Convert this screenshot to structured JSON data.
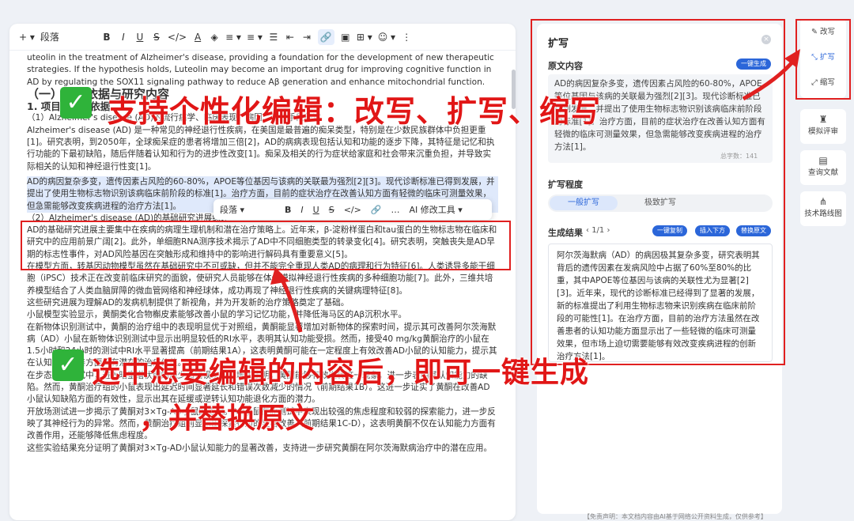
{
  "toolbar": {
    "add": "+ ▾",
    "paragraph": "段落",
    "bold": "B",
    "italic": "I",
    "underline": "U",
    "strike": "S",
    "code": "</>",
    "fontcolor": "A",
    "highlight": "◈",
    "align": "≡ ▾",
    "linespace": "≡ ▾",
    "list": "☰",
    "outdent": "⇤",
    "indent": "⇥",
    "link": "🔗",
    "image": "▣",
    "table": "⊞ ▾",
    "emoji": "☺ ▾",
    "more": "⋮"
  },
  "doc": {
    "intro": "uteolin in the treatment of Alzheimer's disease, providing a foundation for the development of new therapeutic strategies. If the hypothesis holds, Luteolin may become an important drug for improving cognitive function in AD by regulating the SOX11 signaling pathway to reduce Aβ generation and enhance mitochondrial function.",
    "h2": "（一）立项依据与研究内容",
    "h3": "1. 项目的立项依据",
    "sub1": "（1）Alzheimer's disease (AD)的流行病学、临床表现、病因、诊疗手段综述",
    "p1": "Alzheimer's disease (AD) 是一种常见的神经退行性疾病，在美国是最普遍的痴呆类型，特别是在少数民族群体中负担更重[1]。研究表明，到2050年，全球痴呆症的患者将增加三倍[2]，AD的病病表现包括认知和功能的逐步下降，其特征是记忆和执行功能的下最初缺陷，随后伴随着认知和行为的进步性改变[1]。痴呆及相关的行为症状给家庭和社会带来沉重负担，并导致实际相关的认知和神经退行性变[1]。",
    "sel": "AD的病因复杂多变，遗传因素占风险的60-80%，APOE等位基因与该病的关联最为强烈[2][3]。现代诊断标准已得到发展，并提出了使用生物标志物识别该病临床前阶段的标准[1]。治疗方面，目前的症状治疗在改善认知方面有轻微的临床可测量效果，但急需能够改变疾病进程的治疗方法[1]。",
    "sub2": "（2）Alzheimer's disease (AD)的基础研究进展综述",
    "p2": "AD的基础研究进展主要集中在疾病的病理生理机制和潜在治疗策略上。近年来，β-淀粉样蛋白和tau蛋白的生物标志物在临床和研究中的应用前景广阔[2]。此外，单细胞RNA测序技术揭示了AD中不同细胞类型的转录变化[4]。研究表明，突触丧失是AD早期的标志性事件，对AD风险基因在突触形成和维持中的影响进行解码具有重要意义[5]。",
    "p3": "在模型方面，转基因动物模型虽然在基础研究中不可或缺，但并不能完全重现人类AD的病理和行为特征[6]。人类诱导多能干细胞（iPSC）技术正在改变前临床研究的面貌，使研究人员能够在体外模拟神经退行性疾病的多种细胞功能[7]。此外，三维共培养模型结合了人类血脑屏障的微血管网络和神经球体，成功再现了神经退行性疾病的关键病理特征[8]。",
    "p4": "这些研究进展为理解AD的发病机制提供了新视角，并为开发新的治疗策略奠定了基础。",
    "p5": "小鼠模型实验显示，黄酮类化合物槲皮素能够改善小鼠的学习记忆功能，并降低海马区的Aβ沉积水平。",
    "p6": "在新物体识别测试中，黄酮的治疗组中的表现明显优于对照组，黄酮能显著增加对新物体的探索时间，提示其可改善阿尔茨海默病（AD）小鼠在新物体识别测试中显示出明显较低的RI水平，表明其认知功能受损。然而，接受40 mg/kg黄酮治疗的小鼠在1.5小时和24小时的测试中RI水平显著提高（前期结果1A），这表明黄酮可能在一定程度上有效改善AD小鼠的认知能力，提示其在认知功能改善方面具有潜在的治疗价值。",
    "p7": "在步态避免测试中，进入暗室潜伏期的减少和错误次数的增加表明，黄酮能够有效逆转这一现象，进一步表明其认知能力的缺陷。然而，黄酮治疗组的小鼠表现出延迟时间显著延长和错误次数减少的情况（前期结果1B）。这进一步证实了黄酮在改善AD小鼠认知缺陷方面的有效性，显示出其在延缓或逆转认知功能退化方面的潜力。",
    "p8": "开放场测试进一步揭示了黄酮对3×Tg-AD小鼠的影响。AD小鼠在此测试中表现出较强的焦虑程度和较弱的探索能力，进一步反映了其神经行为的异常。然而，黄酮治疗组则显示出探索行为的显著改善（前期结果1C-D），这表明黄酮不仅在认知能力方面有改善作用，还能够降低焦虑程度。",
    "p9": "这些实验结果充分证明了黄酮对3×Tg-AD小鼠认知能力的显著改善，支持进一步研究黄酮在阿尔茨海默病治疗中的潜在应用。"
  },
  "float_bar": {
    "paragraph": "段落 ▾",
    "bold": "B",
    "italic": "I",
    "underline": "U",
    "strike": "S",
    "code": "</>",
    "link": "🔗",
    "more": "…",
    "ai": "AI 修改工具 ▾"
  },
  "panel": {
    "title": "扩写",
    "close": "×",
    "orig_label": "原文内容",
    "orig_btn": "一键生成",
    "orig_text": "AD的病因复杂多变，遗传因素占风险的60-80%，APOE等位基因与该病的关联最为强烈[2][3]。现代诊断标准已得到发展，并提出了使用生物标志物识别该病临床前阶段的标准[1]。治疗方面，目前的症状治疗在改善认知方面有轻微的临床可测量效果，但急需能够改变疾病进程的治疗方法[1]。",
    "wordcount": "总字数：141",
    "degree_label": "扩写程度",
    "opt1": "一般扩写",
    "opt2": "极致扩写",
    "result_label": "生成结果",
    "page": "1/1",
    "btn_copy": "一键复制",
    "btn_insert": "插入下方",
    "btn_replace": "替换原文",
    "result_text": "阿尔茨海默病（AD）的病因极其复杂多变，研究表明其背后的遗传因素在发病风险中占据了60%至80%的比重，其中APOE等位基因与该病的关联性尤为显著[2][3]。近年来，现代的诊断标准已经得到了显著的发展，新的标准提出了利用生物标志物来识别疾病在临床前阶段的可能性[1]。在治疗方面，目前的治疗方法虽然在改善患者的认知功能方面显示出了一些轻微的临床可测量效果，但市场上迫切需要能够有效改变疾病进程的创新治疗方法[1]。"
  },
  "side": {
    "rewrite": "改写",
    "expand": "扩写",
    "shrink": "缩写",
    "review": "模拟评审",
    "refs": "查询文献",
    "roadmap": "技术路线图"
  },
  "overlay": {
    "line1": "支持个性化编辑：改写、扩写、缩写",
    "line2": "选中想要编辑的内容后，即可一键生成",
    "line3": "，并替换原文",
    "check": "✓"
  },
  "footer": "【免责声明：本文档内容由AI基于网络公开资料生成，仅供参考】",
  "colors": {
    "accent": "#2b66d9",
    "red": "#e02020",
    "check": "#2fb33a"
  }
}
